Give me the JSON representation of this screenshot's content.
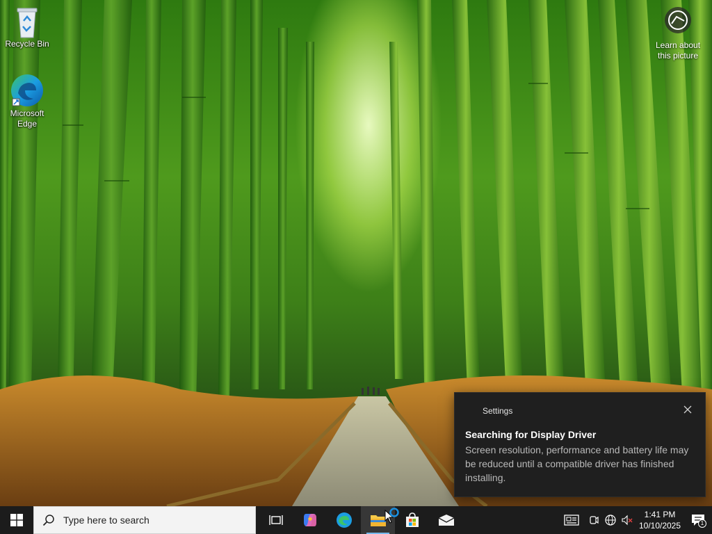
{
  "desktop": {
    "icons": [
      {
        "label_lines": [
          "Recycle Bin"
        ],
        "icon": "recycle-bin-icon"
      },
      {
        "label_lines": [
          "Microsoft",
          "Edge"
        ],
        "icon": "edge-icon"
      }
    ],
    "spotlight": {
      "label_lines": [
        "Learn about",
        "this picture"
      ],
      "icon": "camera-spotlight-icon"
    }
  },
  "toast": {
    "app_name": "Settings",
    "title": "Searching for Display Driver",
    "body": "Screen resolution, performance and battery life may be reduced until a compatible driver has finished installing.",
    "close_icon": "close-icon"
  },
  "taskbar": {
    "start_icon": "windows-logo-icon",
    "search_placeholder": "Type here to search",
    "pinned": [
      {
        "name": "task-view",
        "icon": "task-view-icon"
      },
      {
        "name": "copilot",
        "icon": "copilot-icon"
      },
      {
        "name": "edge",
        "icon": "edge-icon"
      },
      {
        "name": "file-explorer",
        "icon": "folder-icon",
        "active": true
      },
      {
        "name": "microsoft-store",
        "icon": "store-icon"
      },
      {
        "name": "mail",
        "icon": "mail-icon"
      }
    ],
    "tray": {
      "icons": [
        "news-widget-icon",
        "meet-now-icon",
        "network-icon",
        "volume-muted-icon"
      ],
      "time": "1:41 PM",
      "date": "10/10/2025",
      "notification_count": "1"
    }
  },
  "colors": {
    "taskbar_bg": "#1c1c1c",
    "toast_bg": "#1f1f1f",
    "accent": "#76b9ed",
    "edge_blue": "#0c7bd3",
    "edge_green": "#3cc36b"
  }
}
